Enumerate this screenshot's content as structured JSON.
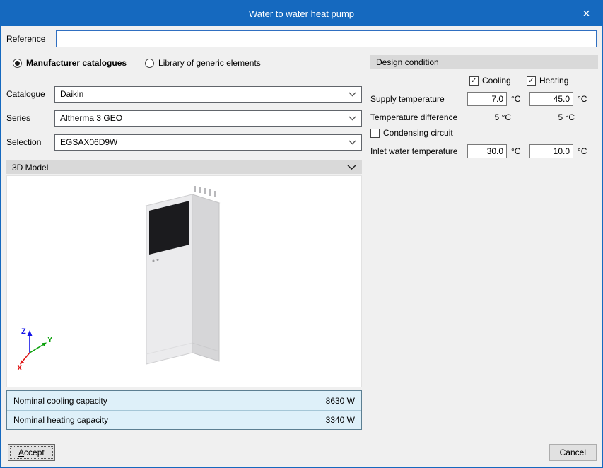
{
  "window": {
    "title": "Water to water heat pump"
  },
  "icons": {
    "close": "✕",
    "check": "✓"
  },
  "reference": {
    "label": "Reference",
    "value": ""
  },
  "catalog_source": {
    "manufacturer_label": "Manufacturer catalogues",
    "library_label": "Library of generic elements"
  },
  "selectors": {
    "catalogue_label": "Catalogue",
    "catalogue_value": "Daikin",
    "series_label": "Series",
    "series_value": "Altherma 3 GEO",
    "selection_label": "Selection",
    "selection_value": "EGSAX06D9W"
  },
  "model_section": {
    "title": "3D Model"
  },
  "axis": {
    "x": "X",
    "y": "Y",
    "z": "Z"
  },
  "capacity": {
    "rows": [
      {
        "label": "Nominal cooling capacity",
        "value": "8630 W"
      },
      {
        "label": "Nominal heating capacity",
        "value": "3340 W"
      }
    ]
  },
  "design": {
    "title": "Design condition",
    "cooling_label": "Cooling",
    "heating_label": "Heating",
    "unit": "°C",
    "supply_label": "Supply temperature",
    "supply_cooling": "7.0",
    "supply_heating": "45.0",
    "tempdiff_label": "Temperature difference",
    "tempdiff_cooling": "5 °C",
    "tempdiff_heating": "5 °C",
    "condensing_label": "Condensing circuit",
    "inlet_label": "Inlet water temperature",
    "inlet_cooling": "30.0",
    "inlet_heating": "10.0"
  },
  "footer": {
    "accept_accel": "A",
    "accept_rest": "ccept",
    "cancel": "Cancel"
  }
}
